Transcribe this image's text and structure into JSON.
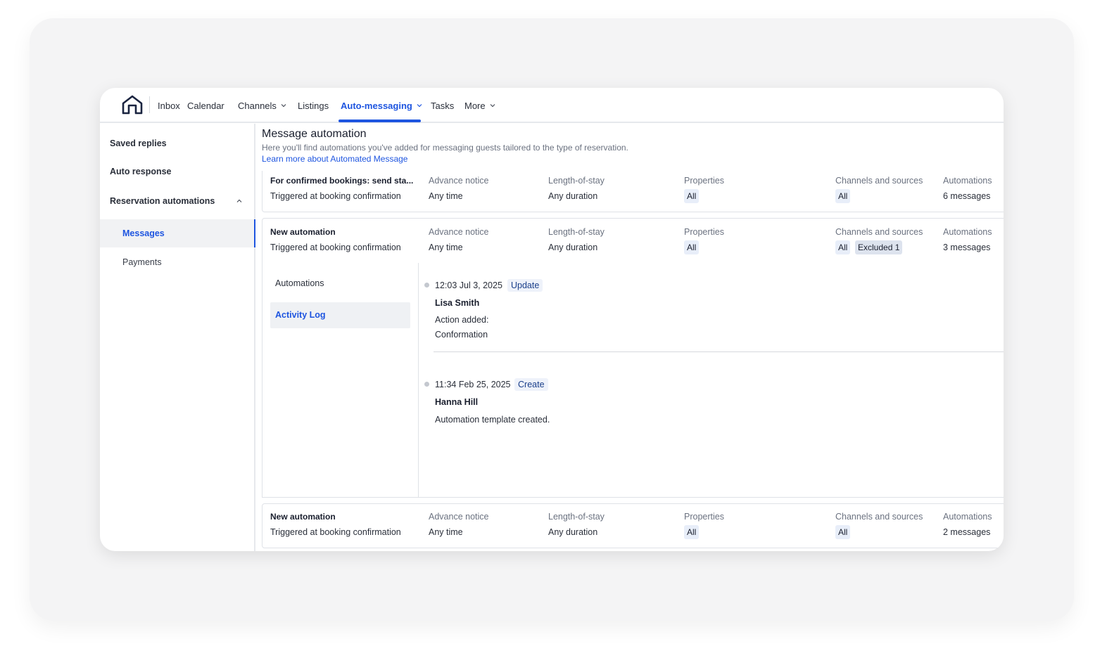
{
  "nav": {
    "items": [
      {
        "label": "Inbox"
      },
      {
        "label": "Calendar"
      },
      {
        "label": "Channels"
      },
      {
        "label": "Listings"
      },
      {
        "label": "Auto-messaging"
      },
      {
        "label": "Tasks"
      },
      {
        "label": "More"
      }
    ],
    "active": "Auto-messaging",
    "icons": {
      "logo": "house-logo-icon",
      "dropdown": "chevron-down-icon"
    }
  },
  "sidebar": {
    "items": [
      {
        "label": "Saved replies"
      },
      {
        "label": "Auto response"
      },
      {
        "label": "Reservation automations"
      }
    ],
    "subitems": [
      {
        "label": "Messages"
      },
      {
        "label": "Payments"
      }
    ],
    "active": "Messages",
    "collapse_icon": "chevron-up-icon"
  },
  "main": {
    "title": "Message automation",
    "subtitle": "Here you'll find automations you've added for messaging guests tailored to the type of reservation.",
    "learn_link": "Learn more about Automated Message"
  },
  "columns": {
    "advance": "Advance notice",
    "length": "Length-of-stay",
    "properties": "Properties",
    "channels": "Channels and sources",
    "automations": "Automations"
  },
  "cards": [
    {
      "name": "For confirmed bookings: send sta...",
      "trigger": "Triggered at booking confirmation",
      "advance": "Any time",
      "length": "Any duration",
      "properties": "All",
      "channels": "All",
      "automations": "6 messages"
    },
    {
      "name": "New automation",
      "trigger": "Triggered at booking confirmation",
      "advance": "Any time",
      "length": "Any duration",
      "properties": "All",
      "channels": "All",
      "excluded": "Excluded 1",
      "automations": "3 messages"
    },
    {
      "name": "New automation",
      "trigger": "Triggered at booking confirmation",
      "advance": "Any time",
      "length": "Any duration",
      "properties": "All",
      "channels": "All",
      "automations": "2 messages"
    }
  ],
  "panel": {
    "tabs": [
      {
        "label": "Automations"
      },
      {
        "label": "Activity Log"
      }
    ],
    "active_tab": "Activity Log",
    "log": [
      {
        "time": "12:03 Jul 3, 2025",
        "tag": "Update",
        "user": "Lisa Smith",
        "line1": "Action added:",
        "line2": "Conformation"
      },
      {
        "time": "11:34 Feb 25, 2025",
        "tag": "Create",
        "user": "Hanna Hill",
        "line1": "Automation template created."
      }
    ]
  },
  "colors": {
    "accent": "#1e55e0",
    "chip": "#e8eef9",
    "border": "#dfe2e7"
  }
}
